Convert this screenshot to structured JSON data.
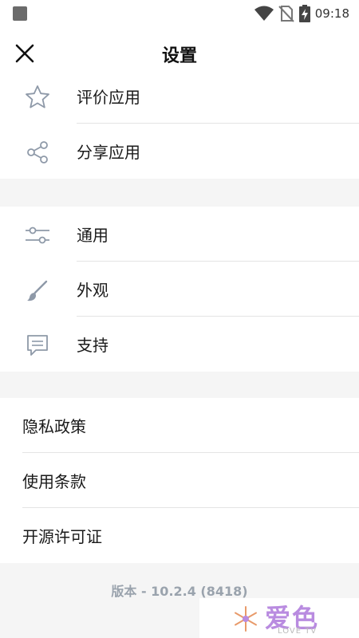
{
  "status": {
    "time": "09:18"
  },
  "header": {
    "title": "设置"
  },
  "section1": [
    {
      "label": "评价应用",
      "icon": "star-icon"
    },
    {
      "label": "分享应用",
      "icon": "share-icon"
    }
  ],
  "section2": [
    {
      "label": "通用",
      "icon": "sliders-icon"
    },
    {
      "label": "外观",
      "icon": "brush-icon"
    },
    {
      "label": "支持",
      "icon": "chat-icon"
    }
  ],
  "section3": [
    {
      "label": "隐私政策"
    },
    {
      "label": "使用条款"
    },
    {
      "label": "开源许可证"
    }
  ],
  "footer": {
    "version": "版本 - 10.2.4 (8418)"
  },
  "watermark": {
    "title": "爱色",
    "subtitle": "LOVE TV"
  },
  "colors": {
    "icon": "#8e99a8",
    "divider": "#e4e4e4",
    "background": "#f5f5f5",
    "version": "#9aa3ad"
  }
}
